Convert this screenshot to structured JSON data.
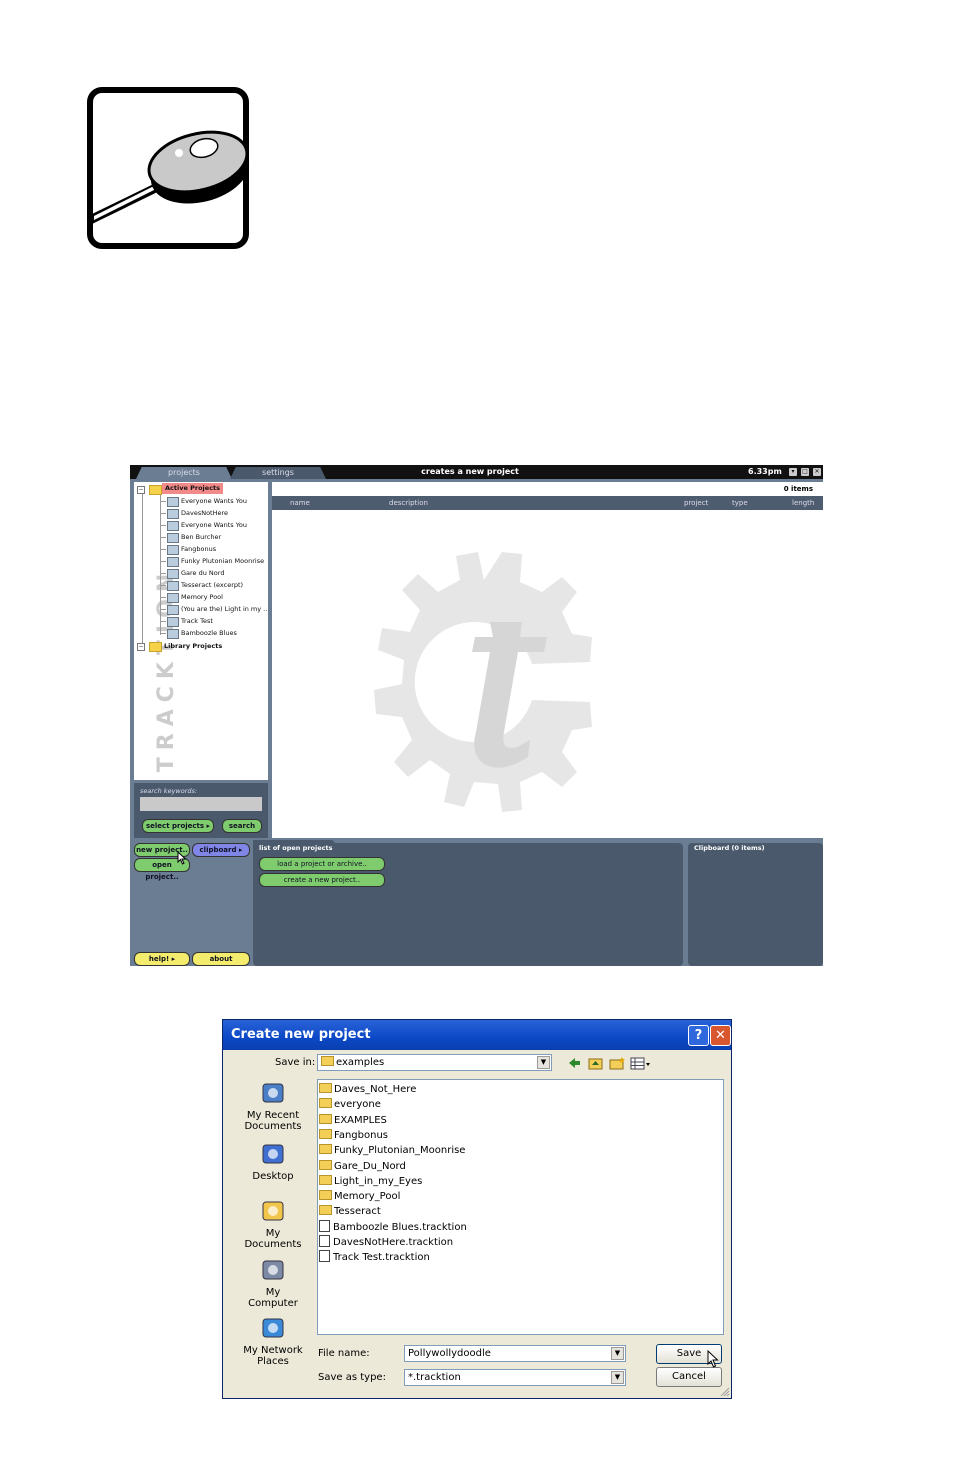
{
  "tracktion": {
    "tabs": [
      "projects",
      "settings"
    ],
    "title": "creates a new project",
    "time": "6.33pm",
    "tree": {
      "active_label": "Active Projects",
      "projects": [
        "Everyone Wants You",
        "DavesNotHere",
        "Everyone Wants You",
        "Ben Burcher",
        "Fangbonus",
        "Funky Plutonian Moonrise",
        "Gare du Nord",
        "Tesseract (excerpt)",
        "Memory Pool",
        "(You are the) Light in my ...",
        "Track Test",
        "Bamboozle Blues"
      ],
      "library_label": "Library Projects",
      "watermark": "TRACKTION"
    },
    "list": {
      "count": "0 items",
      "columns": [
        "name",
        "description",
        "project",
        "type",
        "length"
      ]
    },
    "search": {
      "label": "search keywords:",
      "select_button": "select projects",
      "search_button": "search"
    },
    "buttons": {
      "new_project": "new project..",
      "clipboard": "clipboard",
      "open_project": "open project..",
      "help": "help!",
      "about": "about"
    },
    "open_panel": {
      "title": "list of open projects",
      "load": "load a project or archive..",
      "create": "create a new project.."
    },
    "clip_panel": {
      "title": "Clipboard (0 items)"
    }
  },
  "dialog": {
    "title": "Create new project",
    "help_glyph": "?",
    "close_glyph": "✕",
    "save_in_label": "Save in:",
    "save_in_value": "examples",
    "places": [
      "My Recent Documents",
      "Desktop",
      "My Documents",
      "My Computer",
      "My Network Places"
    ],
    "files": [
      {
        "name": "Daves_Not_Here",
        "kind": "folder"
      },
      {
        "name": "everyone",
        "kind": "folder"
      },
      {
        "name": "EXAMPLES",
        "kind": "folder"
      },
      {
        "name": "Fangbonus",
        "kind": "folder"
      },
      {
        "name": "Funky_Plutonian_Moonrise",
        "kind": "folder"
      },
      {
        "name": "Gare_Du_Nord",
        "kind": "folder"
      },
      {
        "name": "Light_in_my_Eyes",
        "kind": "folder"
      },
      {
        "name": "Memory_Pool",
        "kind": "folder"
      },
      {
        "name": "Tesseract",
        "kind": "folder"
      },
      {
        "name": "Bamboozle Blues.tracktion",
        "kind": "file"
      },
      {
        "name": "DavesNotHere.tracktion",
        "kind": "file"
      },
      {
        "name": "Track Test.tracktion",
        "kind": "file"
      }
    ],
    "file_name_label": "File name:",
    "file_name_value": "Pollywollydoodle",
    "save_type_label": "Save as type:",
    "save_type_value": "*.tracktion",
    "save_button": "Save",
    "cancel_button": "Cancel"
  }
}
